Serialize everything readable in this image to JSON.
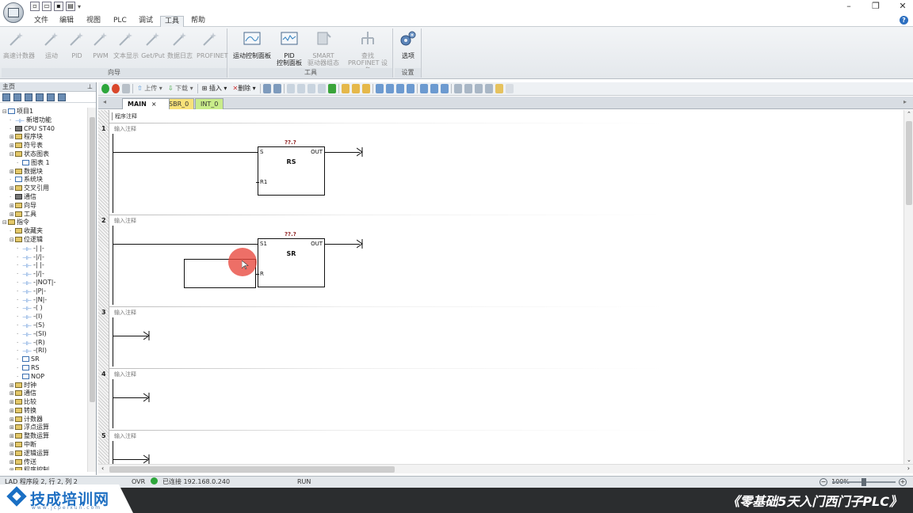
{
  "menu": {
    "tabs": [
      "文件",
      "编辑",
      "视图",
      "PLC",
      "调试",
      "工具",
      "帮助"
    ],
    "active": "工具"
  },
  "ribbon": {
    "wizards": {
      "label": "向导",
      "items": [
        "高速计数器",
        "运动",
        "PID",
        "PWM",
        "文本显示",
        "Get/Put",
        "数据日志",
        "PROFINET"
      ]
    },
    "tools": {
      "label": "工具",
      "items": [
        "运动控制面板",
        "PID\n控制面板",
        "SMART\n驱动器组态",
        "查找\nPROFINET 设备"
      ]
    },
    "settings": {
      "label": "设置",
      "items": [
        "选项"
      ]
    }
  },
  "toolbar": {
    "upload": "上传",
    "download": "下载",
    "insert": "插入",
    "delete": "删除"
  },
  "left_panel": {
    "title": "主页",
    "tree": [
      {
        "indent": 0,
        "exp": "⊟",
        "icon": "box",
        "label": "项目1"
      },
      {
        "indent": 1,
        "exp": "",
        "icon": "bit",
        "label": "新增功能"
      },
      {
        "indent": 1,
        "exp": "",
        "icon": "cpu",
        "label": "CPU ST40"
      },
      {
        "indent": 1,
        "exp": "⊞",
        "icon": "folder",
        "label": "程序块"
      },
      {
        "indent": 1,
        "exp": "⊞",
        "icon": "folder",
        "label": "符号表"
      },
      {
        "indent": 1,
        "exp": "⊟",
        "icon": "folder",
        "label": "状态图表"
      },
      {
        "indent": 2,
        "exp": "",
        "icon": "box",
        "label": "图表 1"
      },
      {
        "indent": 1,
        "exp": "⊞",
        "icon": "folder",
        "label": "数据块"
      },
      {
        "indent": 1,
        "exp": "",
        "icon": "box",
        "label": "系统块"
      },
      {
        "indent": 1,
        "exp": "⊞",
        "icon": "folder",
        "label": "交叉引用"
      },
      {
        "indent": 1,
        "exp": "",
        "icon": "cpu",
        "label": "通信"
      },
      {
        "indent": 1,
        "exp": "⊞",
        "icon": "folder",
        "label": "向导"
      },
      {
        "indent": 1,
        "exp": "⊞",
        "icon": "folder",
        "label": "工具"
      },
      {
        "indent": 0,
        "exp": "⊟",
        "icon": "folder",
        "label": "指令"
      },
      {
        "indent": 1,
        "exp": "",
        "icon": "folder",
        "label": "收藏夹"
      },
      {
        "indent": 1,
        "exp": "⊟",
        "icon": "folder",
        "label": "位逻辑"
      },
      {
        "indent": 2,
        "exp": "",
        "icon": "bit",
        "label": "-| |-"
      },
      {
        "indent": 2,
        "exp": "",
        "icon": "bit",
        "label": "-|/|-"
      },
      {
        "indent": 2,
        "exp": "",
        "icon": "bit",
        "label": "-| |-"
      },
      {
        "indent": 2,
        "exp": "",
        "icon": "bit",
        "label": "-|/|-"
      },
      {
        "indent": 2,
        "exp": "",
        "icon": "bit",
        "label": "-|NOT|-"
      },
      {
        "indent": 2,
        "exp": "",
        "icon": "bit",
        "label": "-|P|-"
      },
      {
        "indent": 2,
        "exp": "",
        "icon": "bit",
        "label": "-|N|-"
      },
      {
        "indent": 2,
        "exp": "",
        "icon": "bit",
        "label": "-( )"
      },
      {
        "indent": 2,
        "exp": "",
        "icon": "bit",
        "label": "-(I)"
      },
      {
        "indent": 2,
        "exp": "",
        "icon": "bit",
        "label": "-(S)"
      },
      {
        "indent": 2,
        "exp": "",
        "icon": "bit",
        "label": "-(SI)"
      },
      {
        "indent": 2,
        "exp": "",
        "icon": "bit",
        "label": "-(R)"
      },
      {
        "indent": 2,
        "exp": "",
        "icon": "bit",
        "label": "-(RI)"
      },
      {
        "indent": 2,
        "exp": "",
        "icon": "box",
        "label": "SR"
      },
      {
        "indent": 2,
        "exp": "",
        "icon": "box",
        "label": "RS"
      },
      {
        "indent": 2,
        "exp": "",
        "icon": "box",
        "label": "NOP"
      },
      {
        "indent": 1,
        "exp": "⊞",
        "icon": "folder",
        "label": "时钟"
      },
      {
        "indent": 1,
        "exp": "⊞",
        "icon": "folder",
        "label": "通信"
      },
      {
        "indent": 1,
        "exp": "⊞",
        "icon": "folder",
        "label": "比较"
      },
      {
        "indent": 1,
        "exp": "⊞",
        "icon": "folder",
        "label": "转换"
      },
      {
        "indent": 1,
        "exp": "⊞",
        "icon": "folder",
        "label": "计数器"
      },
      {
        "indent": 1,
        "exp": "⊞",
        "icon": "folder",
        "label": "浮点运算"
      },
      {
        "indent": 1,
        "exp": "⊞",
        "icon": "folder",
        "label": "整数运算"
      },
      {
        "indent": 1,
        "exp": "⊞",
        "icon": "folder",
        "label": "中断"
      },
      {
        "indent": 1,
        "exp": "⊞",
        "icon": "folder",
        "label": "逻辑运算"
      },
      {
        "indent": 1,
        "exp": "⊞",
        "icon": "folder",
        "label": "传送"
      },
      {
        "indent": 1,
        "exp": "⊞",
        "icon": "folder",
        "label": "程序控制"
      }
    ]
  },
  "editor": {
    "tabs": {
      "main": "MAIN",
      "close": "×",
      "sbr": "SBR_0",
      "int": "INT_0"
    },
    "program_comment": "程序注释",
    "network_comment": "输入注释",
    "networks": [
      {
        "num": "1",
        "block": {
          "name": "RS",
          "set": "S",
          "reset": "R1",
          "out": "OUT",
          "addr": "??.?"
        }
      },
      {
        "num": "2",
        "block": {
          "name": "SR",
          "set": "S1",
          "reset": "R",
          "out": "OUT",
          "addr": "??.?"
        }
      },
      {
        "num": "3"
      },
      {
        "num": "4"
      },
      {
        "num": "5"
      }
    ]
  },
  "status": {
    "position": "LAD 程序段 2, 行 2, 列 2",
    "mode": "OVR",
    "connection": "已连接 192.168.0.240",
    "run": "RUN",
    "zoom": "100%",
    "zoom_fraction": 0.5
  },
  "overlay": {
    "brand": "技成培训网",
    "url": "www.jcpeixun.com",
    "course": "《零基础5天入门西门子PLC》"
  },
  "colors": {
    "connected": "#2da63b",
    "address": "#8b1a1a",
    "sbr_tab": "#f8e27a",
    "int_tab": "#c9ec8a"
  }
}
